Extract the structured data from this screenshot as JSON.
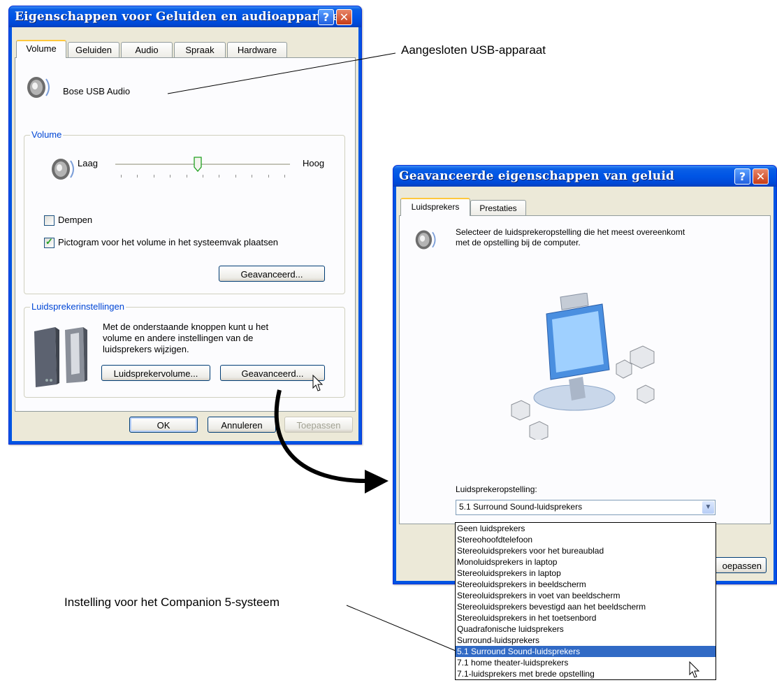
{
  "window1": {
    "title": "Eigenschappen voor Geluiden en audioapparaten",
    "tabs": [
      "Volume",
      "Geluiden",
      "Audio",
      "Spraak",
      "Hardware"
    ],
    "device_name": "Bose USB Audio",
    "volume_group": {
      "label": "Volume",
      "low": "Laag",
      "high": "Hoog",
      "level_fraction": 0.47
    },
    "mute_label": "Dempen",
    "mute_checked": false,
    "tray_label": "Pictogram voor het volume in het systeemvak plaatsen",
    "tray_checked": true,
    "advanced_btn": "Geavanceerd...",
    "speaker_group": {
      "label": "Luidsprekerinstellingen",
      "desc_line1": "Met de onderstaande knoppen kunt u het",
      "desc_line2": "volume en andere instellingen van de",
      "desc_line3": "luidsprekers wijzigen.",
      "speaker_volume_btn": "Luidsprekervolume...",
      "advanced_btn": "Geavanceerd..."
    },
    "ok": "OK",
    "cancel": "Annuleren",
    "apply": "Toepassen"
  },
  "window2": {
    "title": "Geavanceerde eigenschappen van geluid",
    "tabs": [
      "Luidsprekers",
      "Prestaties"
    ],
    "desc_line1": "Selecteer de luidsprekeropstelling die het meest overeenkomt",
    "desc_line2": "met de opstelling bij de computer.",
    "setup_label": "Luidsprekeropstelling:",
    "selected": "5.1 Surround Sound-luidsprekers",
    "apply_partial": "oepassen",
    "options": [
      "Geen luidsprekers",
      "Stereohoofdtelefoon",
      "Stereoluidsprekers voor het bureaublad",
      "Monoluidsprekers in laptop",
      "Stereoluidsprekers in laptop",
      "Stereoluidsprekers in beeldscherm",
      "Stereoluidsprekers in voet van beeldscherm",
      "Stereoluidsprekers bevestigd aan het beeldscherm",
      "Stereoluidsprekers in het toetsenbord",
      "Quadrafonische luidsprekers",
      "Surround-luidsprekers",
      "5.1 Surround Sound-luidsprekers",
      "7.1 home theater-luidsprekers",
      "7.1-luidsprekers met brede opstelling"
    ],
    "selected_index": 11
  },
  "callouts": {
    "usb": "Aangesloten USB-apparaat",
    "companion": "Instelling voor het Companion 5-systeem"
  },
  "colors": {
    "titlebar": "#0055e5",
    "dialog_bg": "#ece9d8",
    "selection": "#316ac5",
    "group_label": "#0046d5"
  }
}
